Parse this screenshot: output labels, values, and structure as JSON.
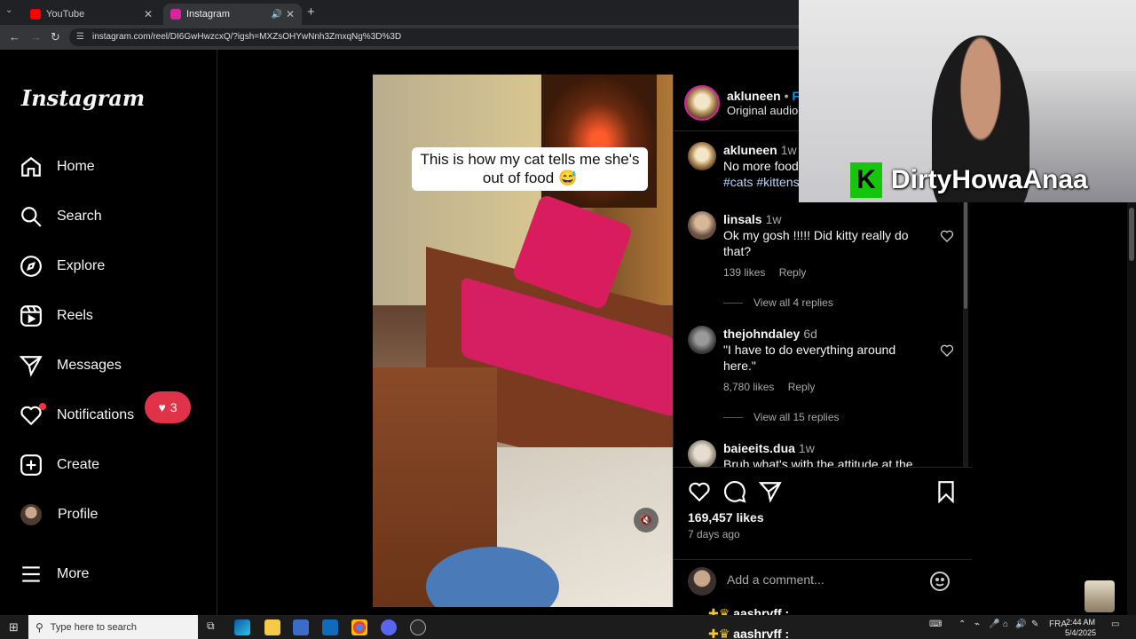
{
  "browser": {
    "tabs": [
      {
        "title": "YouTube",
        "active": false,
        "favicon_color": "#ff0000"
      },
      {
        "title": "Instagram",
        "active": true,
        "favicon_color": "#d6249f"
      }
    ],
    "new_tab_symbol": "+",
    "url": "instagram.com/reel/DI6GwHwzcxQ/?igsh=MXZsOHYwNnh3ZmxqNg%3D%3D"
  },
  "sidebar": {
    "logo": "Instagram",
    "items": [
      {
        "label": "Home",
        "icon": "home-icon"
      },
      {
        "label": "Search",
        "icon": "search-icon"
      },
      {
        "label": "Explore",
        "icon": "compass-icon"
      },
      {
        "label": "Reels",
        "icon": "reels-icon"
      },
      {
        "label": "Messages",
        "icon": "send-icon"
      },
      {
        "label": "Notifications",
        "icon": "heart-icon"
      },
      {
        "label": "Create",
        "icon": "plus-square-icon"
      },
      {
        "label": "Profile",
        "icon": "avatar"
      },
      {
        "label": "More",
        "icon": "menu-icon"
      }
    ],
    "notification_count": "3"
  },
  "reel": {
    "caption_text": "This is how my cat tells me she's out of food 😅"
  },
  "post": {
    "author": "akluneen",
    "follow_label": "Fo",
    "audio": "Original audio",
    "caption": {
      "user": "akluneen",
      "time": "1w",
      "text": "No more food",
      "tags": "#cats #kittens"
    },
    "comments": [
      {
        "user": "linsals",
        "time": "1w",
        "text": "Ok my gosh !!!!! Did kitty really do that?",
        "likes": "139 likes",
        "reply": "Reply",
        "replies": "View all 4 replies"
      },
      {
        "user": "thejohndaley",
        "time": "6d",
        "text": "\"I have to do everything around here.\"",
        "likes": "8,780 likes",
        "reply": "Reply",
        "replies": "View all 15 replies"
      },
      {
        "user": "baieeits.dua",
        "time": "1w",
        "text": "Bruh what's with the attitude at the"
      }
    ],
    "like_count": "169,457 likes",
    "posted": "7 days ago",
    "add_comment_placeholder": "Add a comment..."
  },
  "overlay": {
    "streamer_name": "DirtyHowaAnaa",
    "chat": [
      {
        "user": "aashrvff :"
      },
      {
        "user": "aashrvff :"
      }
    ]
  },
  "taskbar": {
    "search_placeholder": "Type here to search",
    "language": "FRA",
    "time": "2:44 AM",
    "date": "5/4/2025"
  },
  "colors": {
    "background": "#000000",
    "accent_blue": "#0095f6",
    "notification_red": "#e0334a",
    "brand_green": "#16c60c"
  }
}
